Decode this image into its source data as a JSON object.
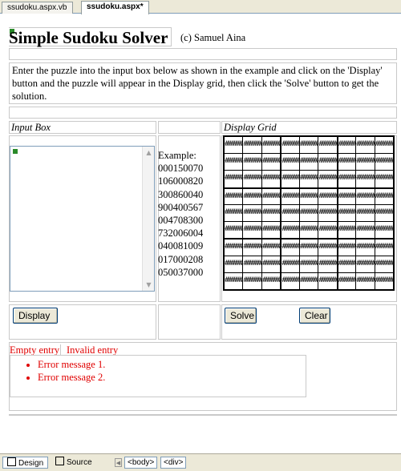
{
  "tabs": [
    {
      "label": "ssudoku.aspx.vb",
      "active": false
    },
    {
      "label": "ssudoku.aspx*",
      "active": true
    }
  ],
  "header": {
    "title": "Simple Sudoku Solver",
    "copyright": "(c) Samuel Aina"
  },
  "instructions": "Enter the puzzle into the input box below as shown in the example and click on the 'Display' button and the puzzle will appear in the Display grid, then click the 'Solve' button to get the solution.",
  "labels": {
    "input_box": "Input Box",
    "display_grid": "Display Grid",
    "example_heading": "Example:"
  },
  "example_rows": [
    "000150070",
    "106000820",
    "300860040",
    "900400567",
    "004708300",
    "732006004",
    "040081009",
    "017000208",
    "050037000"
  ],
  "grid_cell_text": "########",
  "buttons": {
    "display": "Display",
    "solve": "Solve",
    "clear": "Clear"
  },
  "validators": {
    "empty": "Empty entry",
    "invalid": "Invalid entry"
  },
  "errors": [
    "Error message 1.",
    "Error message 2."
  ],
  "statusbar": {
    "design": "Design",
    "source": "Source",
    "crumbs": [
      "<body>",
      "<div>"
    ]
  },
  "colors": {
    "error": "#e00000",
    "grid_border": "#000000"
  }
}
